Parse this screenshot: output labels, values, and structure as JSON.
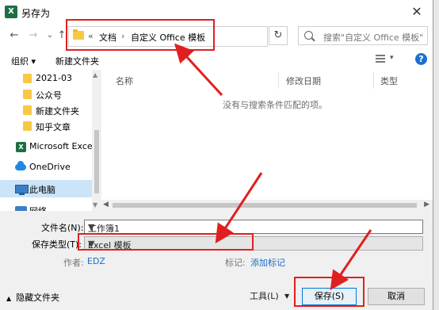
{
  "window": {
    "title": "另存为",
    "app_icon": "X",
    "close_glyph": "✕"
  },
  "nav": {
    "back": "←",
    "forward": "→",
    "dropdown": "⌄",
    "up": "↑"
  },
  "address": {
    "prefix": "«",
    "crumb1": "文档",
    "separator": "›",
    "crumb2": "自定义 Office 模板",
    "dropdown": "⌄",
    "refresh": "↻"
  },
  "search": {
    "placeholder": "搜索\"自定义 Office 模板\""
  },
  "toolbar": {
    "organize": "组织 ▾",
    "new_folder": "新建文件夹",
    "view_dropdown": "▾",
    "help": "?"
  },
  "sidebar": {
    "items": [
      {
        "label": "2021-03",
        "icon": "folder-icon"
      },
      {
        "label": "公众号",
        "icon": "folder-icon"
      },
      {
        "label": "新建文件夹",
        "icon": "folder-icon"
      },
      {
        "label": "知乎文章",
        "icon": "folder-icon"
      },
      {
        "label": "Microsoft Excel",
        "icon": "excel-icon"
      },
      {
        "label": "OneDrive",
        "icon": "onedrive-icon"
      },
      {
        "label": "此电脑",
        "icon": "pc-icon"
      },
      {
        "label": "网络",
        "icon": "network-icon"
      }
    ]
  },
  "file_list": {
    "columns": [
      "名称",
      "修改日期",
      "类型"
    ],
    "empty_message": "没有与搜索条件匹配的项。"
  },
  "form": {
    "filename_label": "文件名(N):",
    "filename_value": "工作簿1",
    "filetype_label": "保存类型(T):",
    "filetype_value": "Excel 模板",
    "author_label": "作者:",
    "author_value": "EDZ",
    "tags_label": "标记:",
    "tags_value": "添加标记"
  },
  "footer": {
    "hide_folders": "隐藏文件夹",
    "tools": "工具(L)",
    "save": "保存(S)",
    "cancel": "取消"
  },
  "colors": {
    "highlight": "#e02020",
    "accent": "#0078d7",
    "link": "#1a6fc4"
  }
}
